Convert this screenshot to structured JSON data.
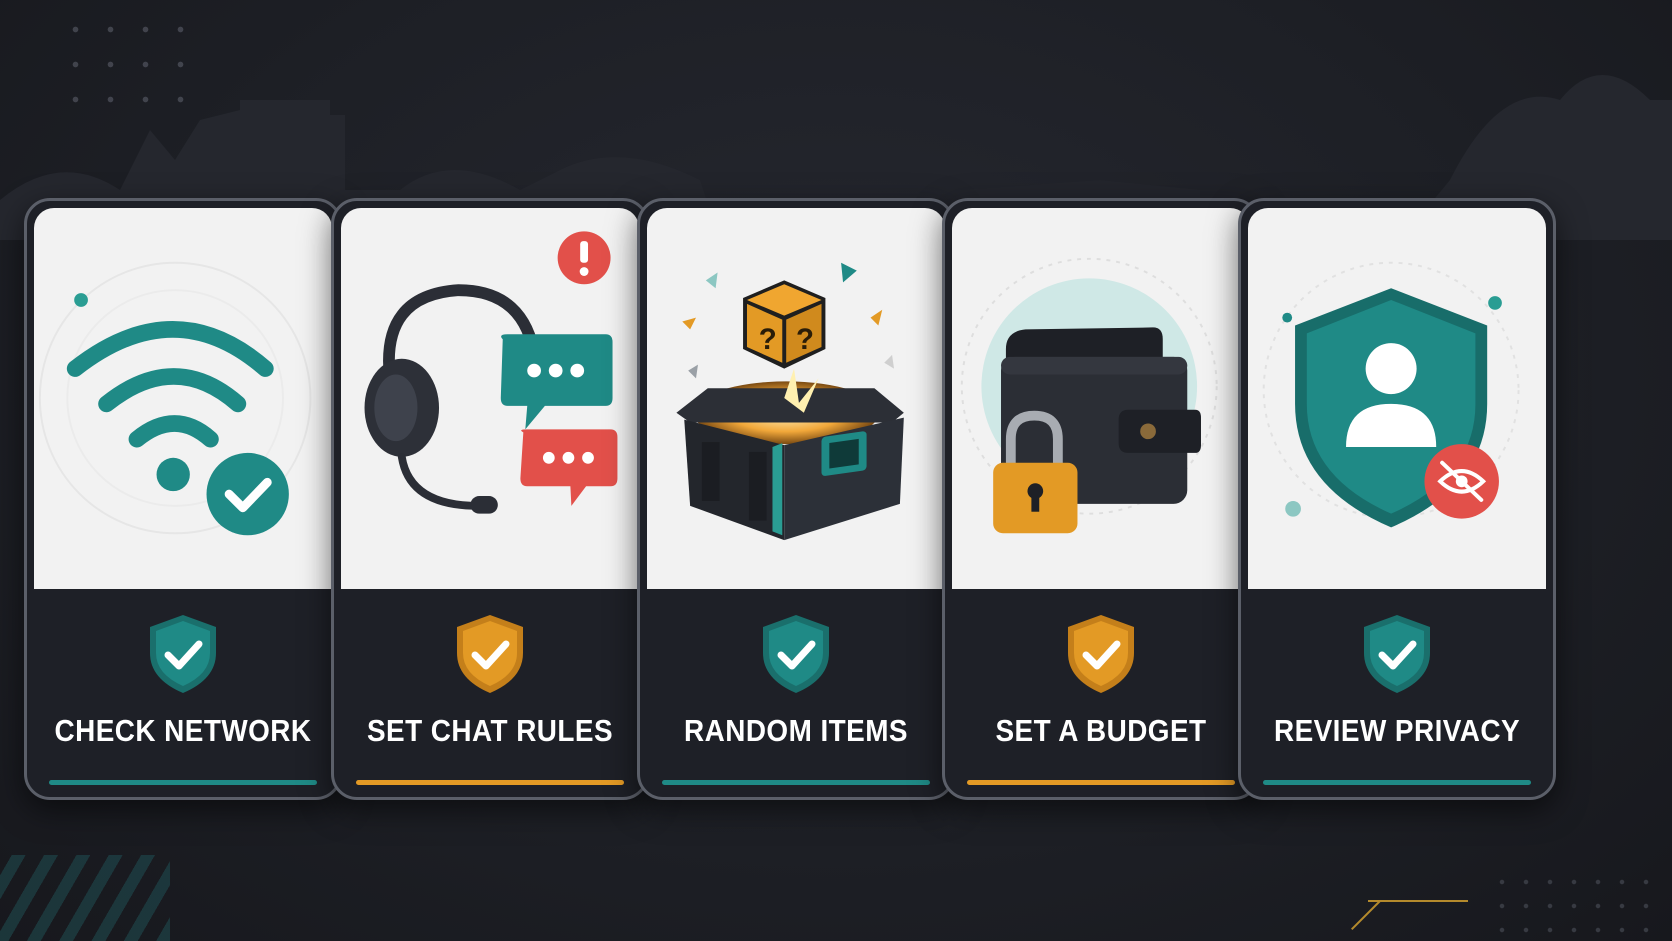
{
  "accent_colors": {
    "teal": "#1f8a86",
    "gold": "#e39a25",
    "red": "#e2504a"
  },
  "cards": [
    {
      "label": "CHECK NETWORK",
      "icon": "wifi-check-icon",
      "badge": "teal-shield-check-icon",
      "accent": "#1f8a86"
    },
    {
      "label": "SET CHAT RULES",
      "icon": "headset-chat-icon",
      "badge": "gold-shield-check-icon",
      "accent": "#e39a25"
    },
    {
      "label": "RANDOM ITEMS",
      "icon": "loot-box-icon",
      "badge": "teal-shield-check-icon",
      "accent": "#1f8a86"
    },
    {
      "label": "SET A BUDGET",
      "icon": "wallet-lock-icon",
      "badge": "gold-shield-check-icon",
      "accent": "#e39a25"
    },
    {
      "label": "REVIEW PRIVACY",
      "icon": "privacy-shield-icon",
      "badge": "teal-shield-check-icon",
      "accent": "#1f8a86"
    }
  ]
}
